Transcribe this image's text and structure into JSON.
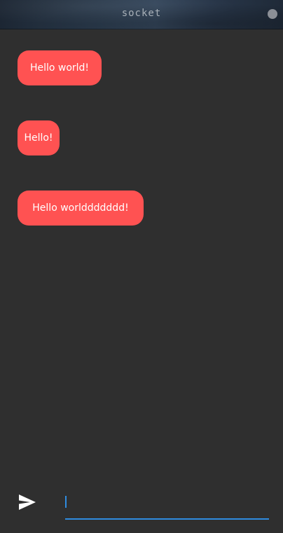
{
  "window": {
    "title": "socket"
  },
  "messages": [
    {
      "text": "Hello world!"
    },
    {
      "text": "Hello!"
    },
    {
      "text": "Hello worlddddddd!"
    }
  ],
  "composer": {
    "input_value": "",
    "placeholder": "",
    "send_icon": "send-icon"
  },
  "colors": {
    "bubble": "#ff5252",
    "background": "#2f2f2f",
    "accent": "#2f8ce0"
  }
}
